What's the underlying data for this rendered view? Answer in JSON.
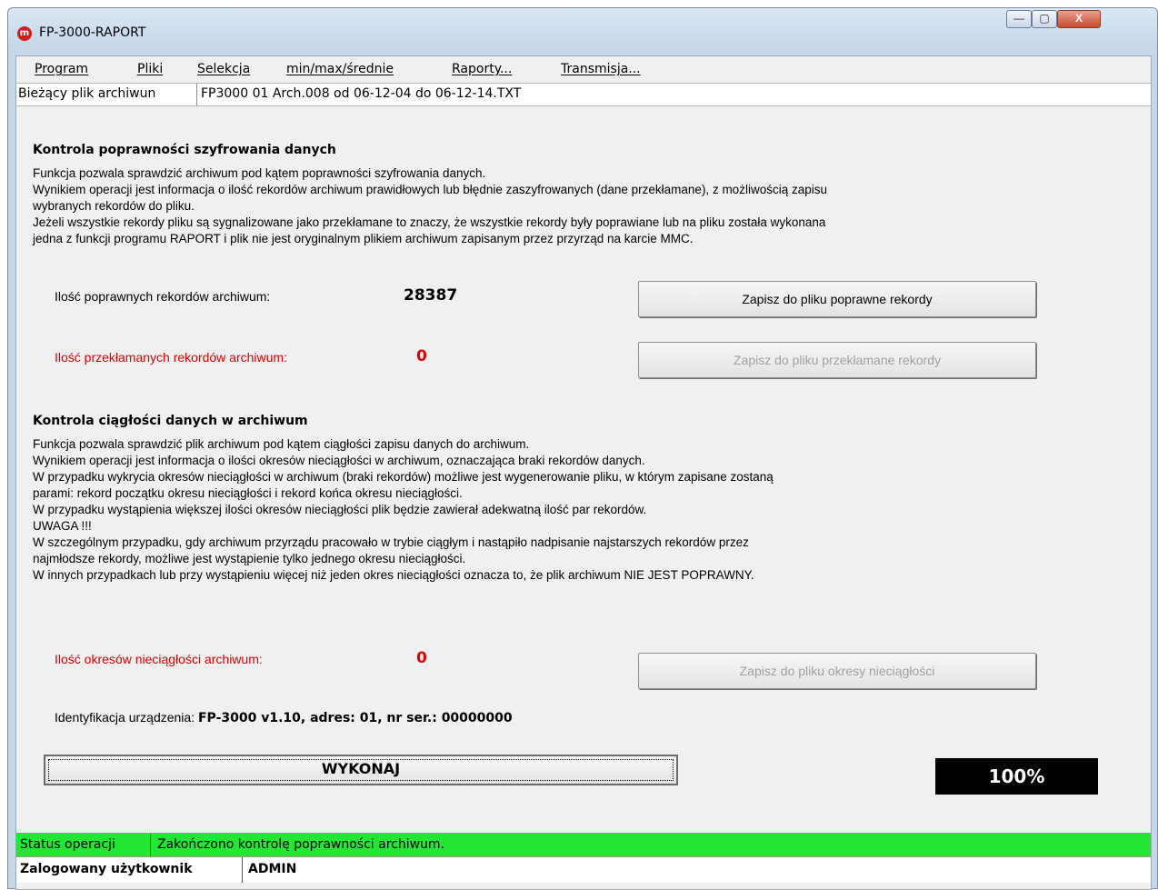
{
  "window": {
    "title": "FP-3000-RAPORT",
    "icon_letter": "m",
    "min": "—",
    "max": "▢",
    "close": "X"
  },
  "menu": [
    "Program",
    "Pliki",
    "Selekcja",
    "min/max/średnie",
    "Raporty...",
    "Transmisja..."
  ],
  "file_bar": {
    "label": "Bieżący plik archiwun",
    "value": "FP3000 01 Arch.008 od 06-12-04 do 06-12-14.TXT"
  },
  "section1": {
    "title": "Kontrola poprawności szyfrowania danych",
    "text": "Funkcja pozwala sprawdzić archiwum pod kątem poprawności szyfrowania danych.\nWynikiem operacji jest informacja o ilość rekordów archiwum prawidłowych lub błędnie zaszyfrowanych (dane przekłamane), z możliwością zapisu\nwybranych rekordów do pliku.\nJeżeli wszystkie rekordy pliku są sygnalizowane jako przekłamane to znaczy, że wszystkie rekordy były poprawiane lub na pliku została wykonana\njedna z funkcji programu RAPORT i plik nie jest oryginalnym plikiem archiwum zapisanym przez przyrząd na karcie MMC.",
    "correct_label": "Ilość poprawnych rekordów archiwum:",
    "correct_value": "28387",
    "correct_button": "Zapisz do pliku poprawne rekordy",
    "corrupt_label": "Ilość przekłamanych rekordów archiwum:",
    "corrupt_value": "0",
    "corrupt_button": "Zapisz do pliku przekłamane rekordy"
  },
  "section2": {
    "title": "Kontrola ciągłości danych w archiwum",
    "text": "Funkcja pozwala sprawdzić plik archiwum pod kątem ciągłości zapisu danych do archiwum.\nWynikiem operacji jest informacja o ilości okresów nieciągłości w archiwum, oznaczająca braki rekordów danych.\nW przypadku wykrycia okresów nieciągłości w archiwum (braki rekordów) możliwe jest wygenerowanie pliku, w którym zapisane zostaną\nparami: rekord początku okresu nieciągłości i rekord końca okresu nieciągłości.\nW przypadku wystąpienia większej ilości okresów nieciągłości plik będzie zawierał adekwatną ilość par rekordów.\nUWAGA !!!\nW szczególnym przypadku, gdy archiwum przyrządu pracowało w trybie ciągłym i nastąpiło nadpisanie najstarszych rekordów przez\nnajmłodsze rekordy, możliwe jest wystąpienie  tylko jednego okresu nieciągłości.\nW innych przypadkach lub przy wystąpieniu więcej niż jeden okres nieciągłości oznacza to, że plik archiwum NIE JEST POPRAWNY.",
    "gaps_label": "Ilość okresów nieciągłości archiwum:",
    "gaps_value": "0",
    "gaps_button": "Zapisz do pliku okresy nieciągłości"
  },
  "device": {
    "label": "Identyfikacja urządzenia:",
    "value": "FP-3000 v1.10, adres: 01, nr ser.: 00000000"
  },
  "execute_button": "WYKONAJ",
  "progress": {
    "text": "100%",
    "percent": 100
  },
  "status": {
    "label": "Status operacji",
    "value": "Zakończono kontrolę poprawności archiwum.",
    "color": "#22e833"
  },
  "user": {
    "label": "Zalogowany użytkownik",
    "value": "ADMIN"
  }
}
